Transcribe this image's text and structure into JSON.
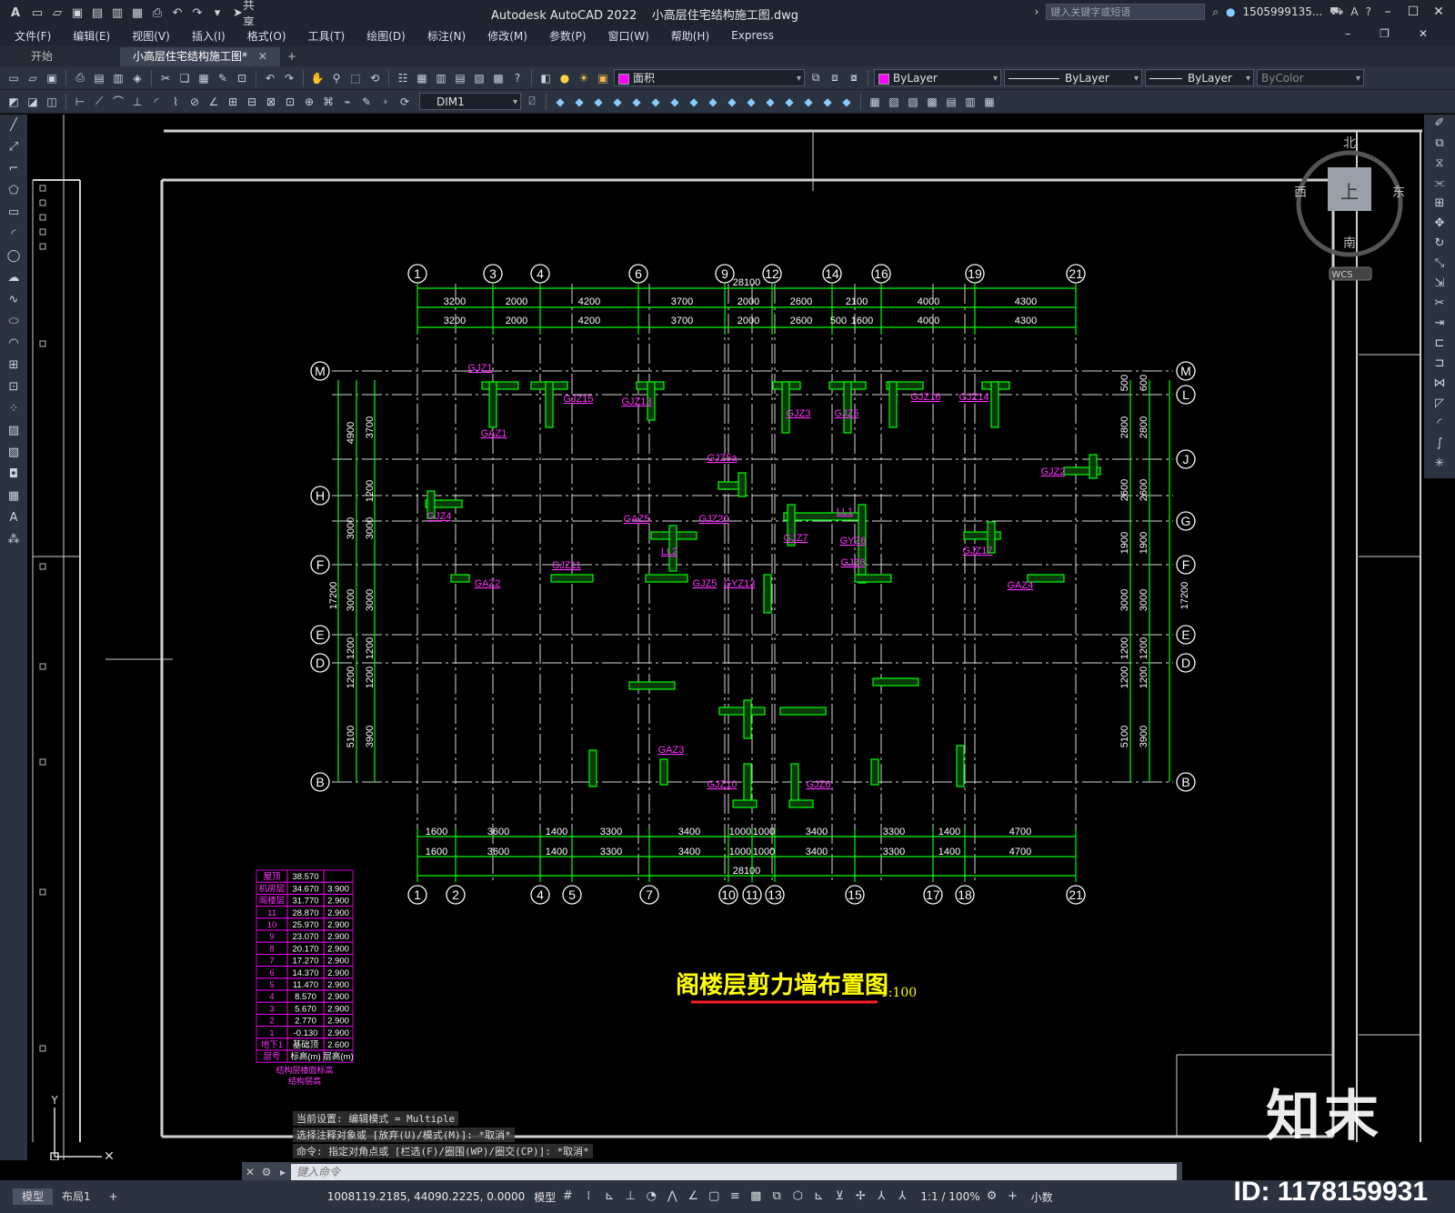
{
  "app": {
    "title": "Autodesk AutoCAD 2022",
    "filename": "小高层住宅结构施工图.dwg",
    "search_placeholder": "键入关键字或短语",
    "user": "1505999135...",
    "share_label": "共享",
    "logo": "A"
  },
  "menu": [
    "文件(F)",
    "编辑(E)",
    "视图(V)",
    "插入(I)",
    "格式(O)",
    "工具(T)",
    "绘图(D)",
    "标注(N)",
    "修改(M)",
    "参数(P)",
    "窗口(W)",
    "帮助(H)",
    "Express"
  ],
  "tabs": [
    "开始",
    "小高层住宅结构施工图*",
    "+"
  ],
  "toolbar": {
    "layer": "面积",
    "color": "ByLayer",
    "linetype": "ByLayer",
    "lineweight": "ByLayer",
    "plotstyle": "ByColor",
    "dimstyle": "DIM1"
  },
  "viewcube": {
    "north": "北",
    "south": "南",
    "east": "东",
    "west": "西",
    "top": "上",
    "wcs": "WCS"
  },
  "drawing": {
    "title": "阁楼层剪力墙布置图",
    "scale": "1:100",
    "overall": "28100",
    "overall_v": "17200",
    "top_axes": [
      "1",
      "3",
      "4",
      "6",
      "9",
      "12",
      "14",
      "16",
      "19",
      "21"
    ],
    "bottom_axes": [
      "1",
      "2",
      "4",
      "5",
      "7",
      "10",
      "11",
      "13",
      "15",
      "17",
      "18",
      "21"
    ],
    "left_axes": [
      "M",
      "H",
      "F",
      "E",
      "D",
      "B"
    ],
    "right_axes": [
      "M",
      "L",
      "J",
      "G",
      "F",
      "E",
      "D",
      "B"
    ],
    "top_dims_1": [
      "3200",
      "2000",
      "4200",
      "3700",
      "2000",
      "2600",
      "2100",
      "4000",
      "4300"
    ],
    "top_dims_2": [
      "3200",
      "2000",
      "4200",
      "3700",
      "2000",
      "2600",
      "500",
      "1600",
      "4000",
      "4300"
    ],
    "bottom_dims_1": [
      "1600",
      "3600",
      "1400",
      "3300",
      "3400",
      "1000",
      "1000",
      "3400",
      "3300",
      "1400",
      "4700"
    ],
    "bottom_dims_2": [
      "1600",
      "3600",
      "1400",
      "3300",
      "3400",
      "1000",
      "1000",
      "3400",
      "3300",
      "1400",
      "4700"
    ],
    "left_dims_outer": [
      "4900",
      "3000",
      "3000",
      "1200",
      "1200",
      "5100"
    ],
    "left_dims_inner": [
      "3700",
      "1200",
      "3000",
      "3000",
      "1200",
      "1200",
      "3900"
    ],
    "right_dims_inner": [
      "600",
      "2800",
      "2600",
      "1900",
      "3000",
      "1200",
      "1200",
      "3900"
    ],
    "right_dims_outer": [
      "500",
      "2800",
      "2600",
      "1900",
      "3000",
      "1200",
      "1200",
      "5100"
    ],
    "labels": [
      "GJZ1",
      "GJZ15",
      "GAZ1",
      "GJZ13",
      "GJZ3",
      "GJZ5",
      "GJZ16",
      "GJZ5a",
      "GJZ4",
      "GJZ20",
      "GJZ7",
      "GYZ6",
      "GJZ8",
      "GJZ11",
      "GAZ2",
      "GJZ5",
      "GYZ13",
      "GAZ5",
      "GJZ17",
      "GAZ3",
      "GJZ10",
      "GJZ6",
      "LL1",
      "LL2",
      "GAZ4",
      "GJZ14",
      "GJZ2"
    ],
    "floor_table": {
      "rows": [
        [
          "屋顶",
          "38.570",
          ""
        ],
        [
          "机房层",
          "34.670",
          "3.900"
        ],
        [
          "阁楼层",
          "31.770",
          "2.900"
        ],
        [
          "11",
          "28.870",
          "2.900"
        ],
        [
          "10",
          "25.970",
          "2.900"
        ],
        [
          "9",
          "23.070",
          "2.900"
        ],
        [
          "8",
          "20.170",
          "2.900"
        ],
        [
          "7",
          "17.270",
          "2.900"
        ],
        [
          "6",
          "14.370",
          "2.900"
        ],
        [
          "5",
          "11.470",
          "2.900"
        ],
        [
          "4",
          "8.570",
          "2.900"
        ],
        [
          "3",
          "5.670",
          "2.900"
        ],
        [
          "2",
          "2.770",
          "2.900"
        ],
        [
          "1",
          "-0.130",
          "2.900"
        ],
        [
          "地下1",
          "基础顶",
          "2.600"
        ],
        [
          "层号",
          "标高(m)",
          "层高(m)"
        ]
      ],
      "caption1": "结构层楼面标高",
      "caption2": "结构层高"
    }
  },
  "command": {
    "history": [
      "当前设置: 编辑模式 = Multiple",
      "选择注释对象或 [放弃(U)/模式(M)]: *取消*",
      "命令: 指定对角点或 [栏选(F)/圈围(WP)/圈交(CP)]: *取消*"
    ],
    "placeholder": "键入命令"
  },
  "status": {
    "tabs": [
      "模型",
      "布局1",
      "+"
    ],
    "coords": "1008119.2185, 44090.2225, 0.0000",
    "space": "模型",
    "scale": "1:1 / 100%",
    "units": "小数"
  },
  "watermark": {
    "logo": "知末",
    "id": "ID: 1178159931"
  }
}
